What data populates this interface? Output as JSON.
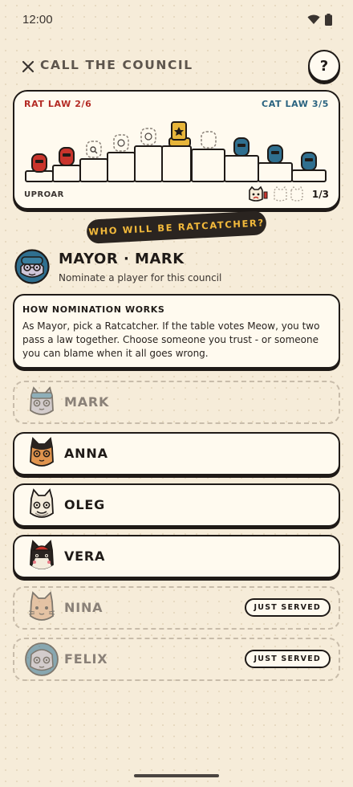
{
  "status_bar": {
    "time": "12:00",
    "icons": [
      "wifi-icon",
      "battery-icon"
    ]
  },
  "header": {
    "title": "CALL THE COUNCIL",
    "close_icon": "close-icon",
    "help_label": "?"
  },
  "board": {
    "rat_law": "RAT LAW 2/6",
    "cat_law": "CAT LAW 3/5",
    "uproar_label": "UPROAR",
    "uproar_count": "1/3",
    "colors": {
      "rat": "#c9342c",
      "cat": "#2f6f8f",
      "crown": "#e7b53a"
    }
  },
  "banner": {
    "text": "WHO WILL BE RATCATCHER?"
  },
  "mayor": {
    "title": "MAYOR · MARK",
    "subtitle": "Nominate a player for this council"
  },
  "info": {
    "title": "HOW NOMINATION WORKS",
    "text": "As Mayor, pick a Ratcatcher. If the table votes Meow, you two pass a law together. Choose someone you trust - or someone you can blame when it all goes wrong."
  },
  "players": [
    {
      "name": "MARK",
      "state": "disabled",
      "badge": ""
    },
    {
      "name": "ANNA",
      "state": "selectable",
      "badge": ""
    },
    {
      "name": "OLEG",
      "state": "selectable",
      "badge": ""
    },
    {
      "name": "VERA",
      "state": "selectable",
      "badge": ""
    },
    {
      "name": "NINA",
      "state": "disabled",
      "badge": "JUST SERVED"
    },
    {
      "name": "FELIX",
      "state": "disabled",
      "badge": "JUST SERVED"
    }
  ]
}
